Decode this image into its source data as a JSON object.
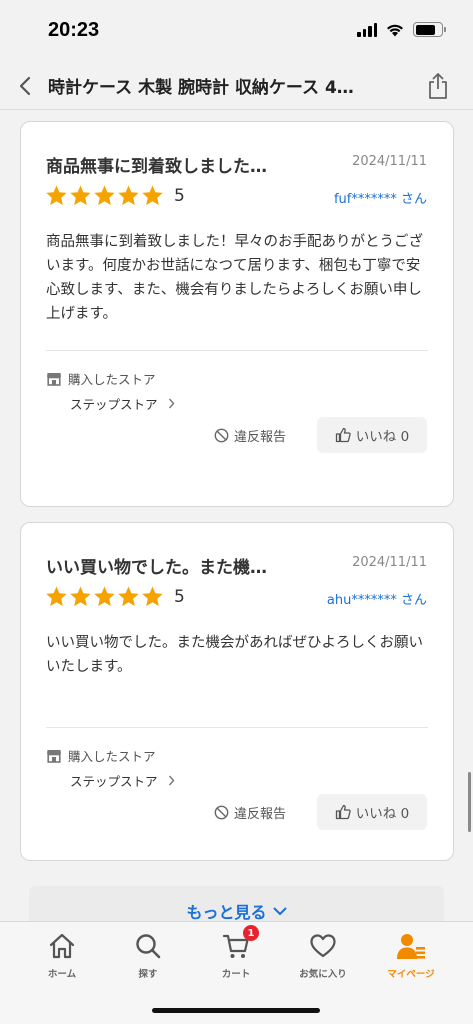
{
  "status_bar": {
    "time": "20:23"
  },
  "header": {
    "title": "時計ケース 木製 腕時計 収納ケース 4…"
  },
  "reviews": [
    {
      "title": "商品無事に到着致しました…",
      "date": "2024/11/11",
      "rating": "5",
      "reviewer": "fuf******* さん",
      "body": "商品無事に到着致しました！早々のお手配ありがとうございます。何度かお世話になつて居ります、梱包も丁寧で安心致します、また、機会有りましたらよろしくお願い申し上げます。",
      "store_label": "購入したストア",
      "store_name": "ステップストア",
      "report_label": "違反報告",
      "like_label": "いいね 0"
    },
    {
      "title": "いい買い物でした。また機…",
      "date": "2024/11/11",
      "rating": "5",
      "reviewer": "ahu******* さん",
      "body": "いい買い物でした。また機会があればぜひよろしくお願いいたします。",
      "store_label": "購入したストア",
      "store_name": "ステップストア",
      "report_label": "違反報告",
      "like_label": "いいね 0"
    }
  ],
  "more_button": {
    "label": "もっと見る"
  },
  "tab_bar": {
    "tabs": [
      {
        "label": "ホーム",
        "icon": "home-icon"
      },
      {
        "label": "探す",
        "icon": "search-icon"
      },
      {
        "label": "カート",
        "icon": "cart-icon",
        "badge": "1"
      },
      {
        "label": "お気に入り",
        "icon": "heart-icon"
      },
      {
        "label": "マイページ",
        "icon": "person-icon"
      }
    ]
  },
  "colors": {
    "accent": "#f28a00",
    "link": "#1a6fd8",
    "star": "#f5a300",
    "badge": "#e8232e"
  }
}
